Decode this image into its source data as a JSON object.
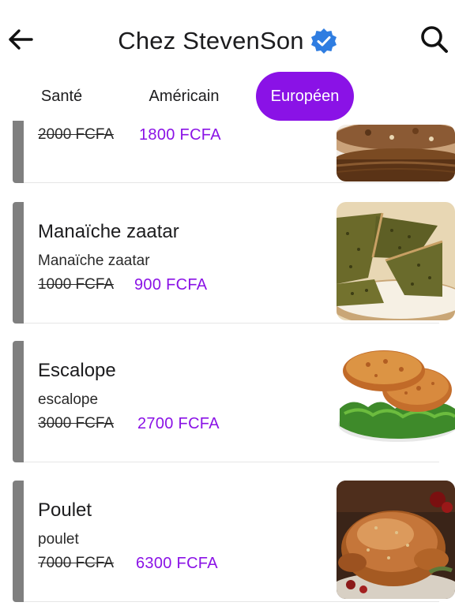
{
  "header": {
    "title": "Chez StevenSon",
    "back_icon": "arrow-left-icon",
    "verified_icon": "verified-badge-icon",
    "search_icon": "search-icon"
  },
  "tabs": [
    {
      "label": "Santé",
      "active": false
    },
    {
      "label": "Américain",
      "active": false
    },
    {
      "label": "Européen",
      "active": true
    }
  ],
  "colors": {
    "accent": "#8a12e6",
    "verified": "#2f7de1",
    "bar": "#7f7f7f"
  },
  "items": [
    {
      "name": "",
      "description": "",
      "old_price": "2000 FCFA",
      "price": "1800 FCFA",
      "image": "pizza-image"
    },
    {
      "name": "Manaïche zaatar",
      "description": "Manaïche zaatar",
      "old_price": "1000 FCFA",
      "price": "900 FCFA",
      "image": "manaiche-image"
    },
    {
      "name": "Escalope",
      "description": "escalope",
      "old_price": "3000 FCFA",
      "price": "2700 FCFA",
      "image": "escalope-image"
    },
    {
      "name": "Poulet",
      "description": "poulet",
      "old_price": "7000 FCFA",
      "price": "6300 FCFA",
      "image": "roast-chicken-image"
    }
  ]
}
